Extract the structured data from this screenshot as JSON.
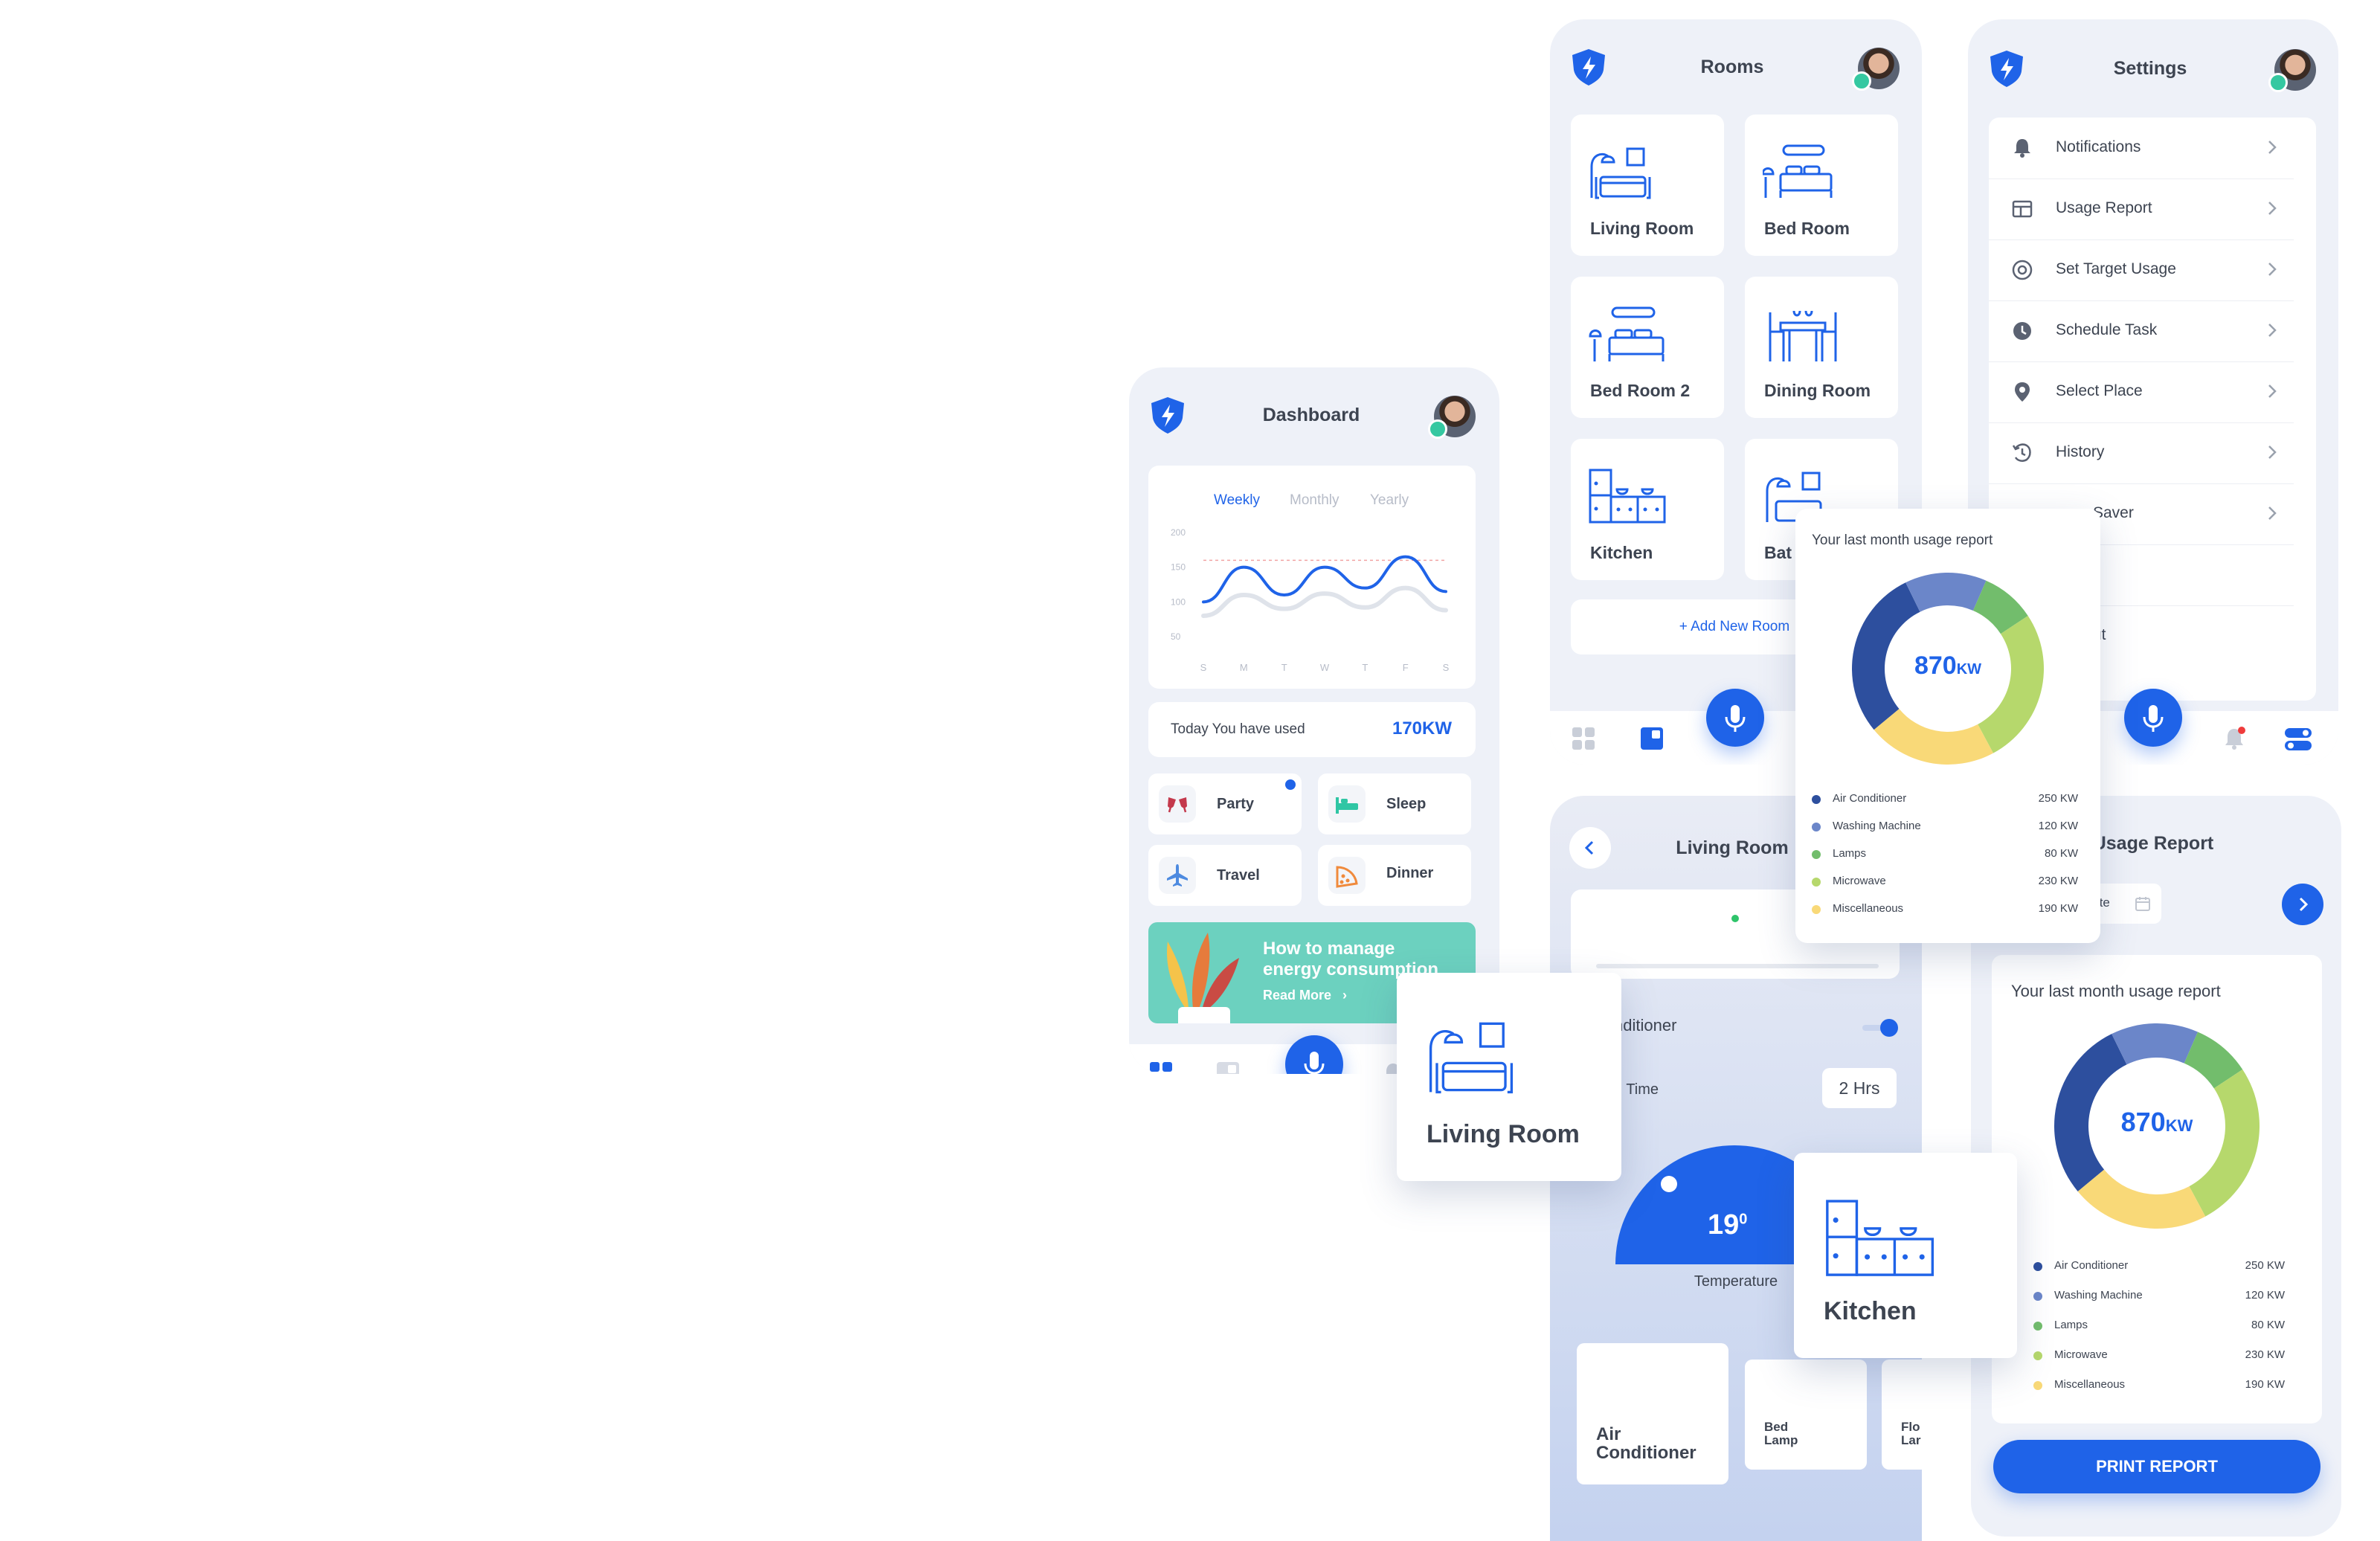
{
  "app": {
    "brand_color": "#1f63e8",
    "accent_teal": "#6cd1bf",
    "status_green": "#35c8a1"
  },
  "dashboard": {
    "title": "Dashboard",
    "tabs": [
      {
        "label": "Weekly",
        "active": true
      },
      {
        "label": "Monthly",
        "active": false
      },
      {
        "label": "Yearly",
        "active": false
      }
    ],
    "today_label": "Today You have used",
    "today_value": "170KW",
    "modes": [
      {
        "label": "Party",
        "icon": "party-glasses-icon"
      },
      {
        "label": "Sleep",
        "icon": "bed-icon"
      },
      {
        "label": "Travel",
        "icon": "airplane-icon"
      },
      {
        "label": "Dinner",
        "icon": "pizza-icon"
      }
    ],
    "promo": {
      "title": "How to manage energy consumption",
      "cta": "Read More"
    }
  },
  "chart_data": {
    "type": "line",
    "categories": [
      "S",
      "M",
      "T",
      "W",
      "T",
      "F",
      "S"
    ],
    "ylim": [
      50,
      200
    ],
    "yticks": [
      200,
      150,
      100,
      50
    ],
    "target_line": 160,
    "series": [
      {
        "values": [
          100,
          150,
          110,
          150,
          120,
          165,
          115
        ],
        "color": "#1f63e8"
      },
      {
        "values": [
          80,
          110,
          90,
          112,
          92,
          120,
          88
        ],
        "color": "#dfe3ea"
      }
    ],
    "grid": false,
    "legend": "none"
  },
  "rooms": {
    "title": "Rooms",
    "items": [
      {
        "label": "Living Room",
        "icon": "sofa-lamp-icon"
      },
      {
        "label": "Bed Room",
        "icon": "bed-lamp-icon"
      },
      {
        "label": "Bed Room 2",
        "icon": "bed-lamp-icon"
      },
      {
        "label": "Dining Room",
        "icon": "dining-table-icon"
      },
      {
        "label": "Kitchen",
        "icon": "kitchen-icon"
      },
      {
        "label": "Bat",
        "icon": "bath-icon"
      }
    ],
    "add_label": "+ Add New Room"
  },
  "settings": {
    "title": "Settings",
    "items": [
      {
        "label": "Notifications",
        "icon": "bell-icon"
      },
      {
        "label": "Usage Report",
        "icon": "table-icon"
      },
      {
        "label": "Set Target Usage",
        "icon": "target-icon"
      },
      {
        "label": "Schedule Task",
        "icon": "clock-icon"
      },
      {
        "label": "Select Place",
        "icon": "pin-icon"
      },
      {
        "label": "History",
        "icon": "history-icon"
      },
      {
        "label": "Saver",
        "icon": "saver-icon"
      }
    ],
    "logout_fragment": "ut"
  },
  "usage_popup": {
    "title": "Your last month usage report",
    "total": "870",
    "unit": "KW",
    "breakdown": [
      {
        "name": "Air Conditioner",
        "value": "250 KW",
        "kw": 250,
        "color": "#2d4f9e"
      },
      {
        "name": "Washing Machine",
        "value": "120 KW",
        "kw": 120,
        "color": "#6b86c9"
      },
      {
        "name": "Lamps",
        "value": "80 KW",
        "kw": 80,
        "color": "#72bd6c"
      },
      {
        "name": "Microwave",
        "value": "230 KW",
        "kw": 230,
        "color": "#b6d86c"
      },
      {
        "name": "Miscellaneous",
        "value": "190 KW",
        "kw": 190,
        "color": "#f9d978"
      }
    ]
  },
  "living_room": {
    "title": "Living Room",
    "device_label": "nditioner",
    "time_label": "n Time",
    "time_value": "2 Hrs",
    "temperature_value": "19",
    "temperature_unit": "0",
    "temperature_label": "Temperature",
    "devices": [
      {
        "label": "Air Conditioner"
      },
      {
        "label": "Bed Lamp"
      },
      {
        "label": "Flo Lar"
      }
    ]
  },
  "usage_report": {
    "title": "Usage Report",
    "end_date_placeholder": "End Date",
    "print_label": "PRINT REPORT"
  },
  "floating": {
    "living_room_label": "Living Room",
    "kitchen_label": "Kitchen"
  }
}
